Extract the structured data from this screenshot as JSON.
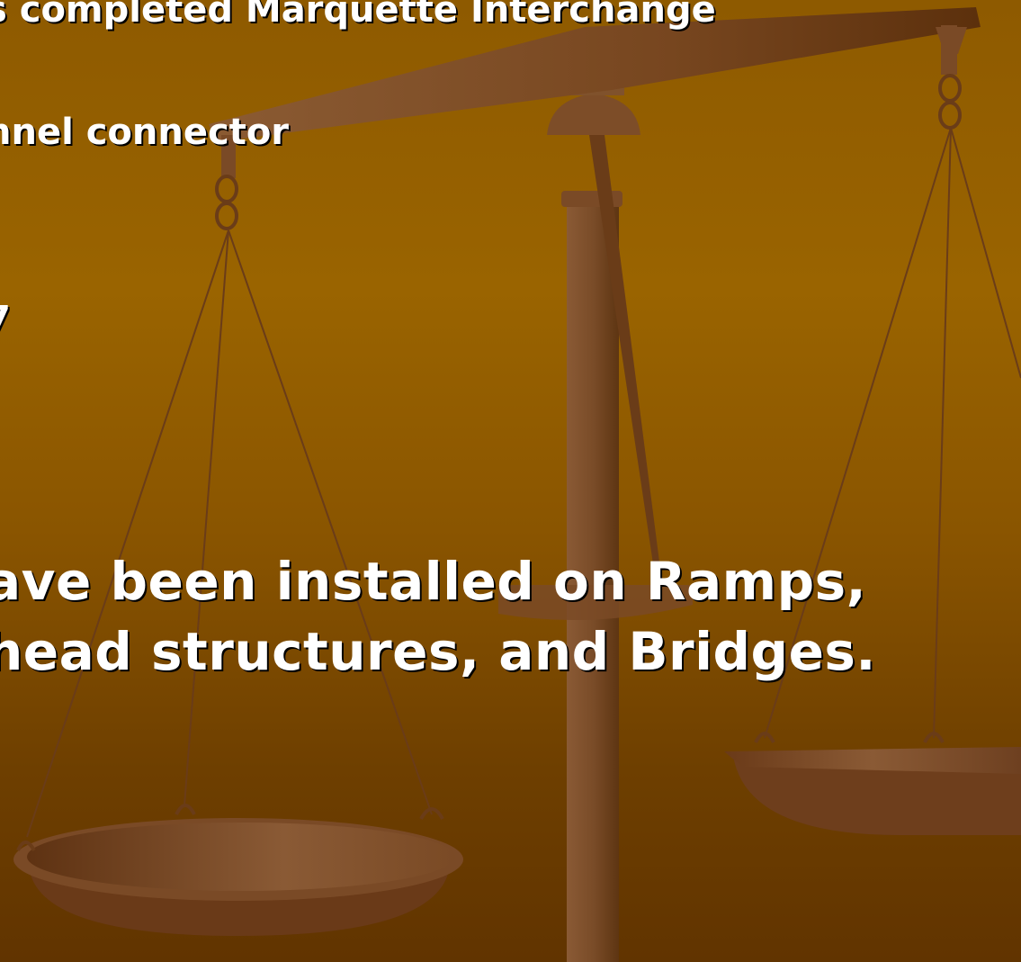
{
  "slide": {
    "lines": [
      "s completed Marquette Interchange",
      "nnel connector",
      "7",
      "ave been installed on Ramps,",
      "head structures, and Bridges."
    ]
  },
  "background": {
    "image": "scales-of-justice-illustration",
    "colors": {
      "top": "#8e5a00",
      "bottom": "#613400",
      "scale_light": "#8a5a35",
      "scale_dark": "#5e3512"
    }
  }
}
